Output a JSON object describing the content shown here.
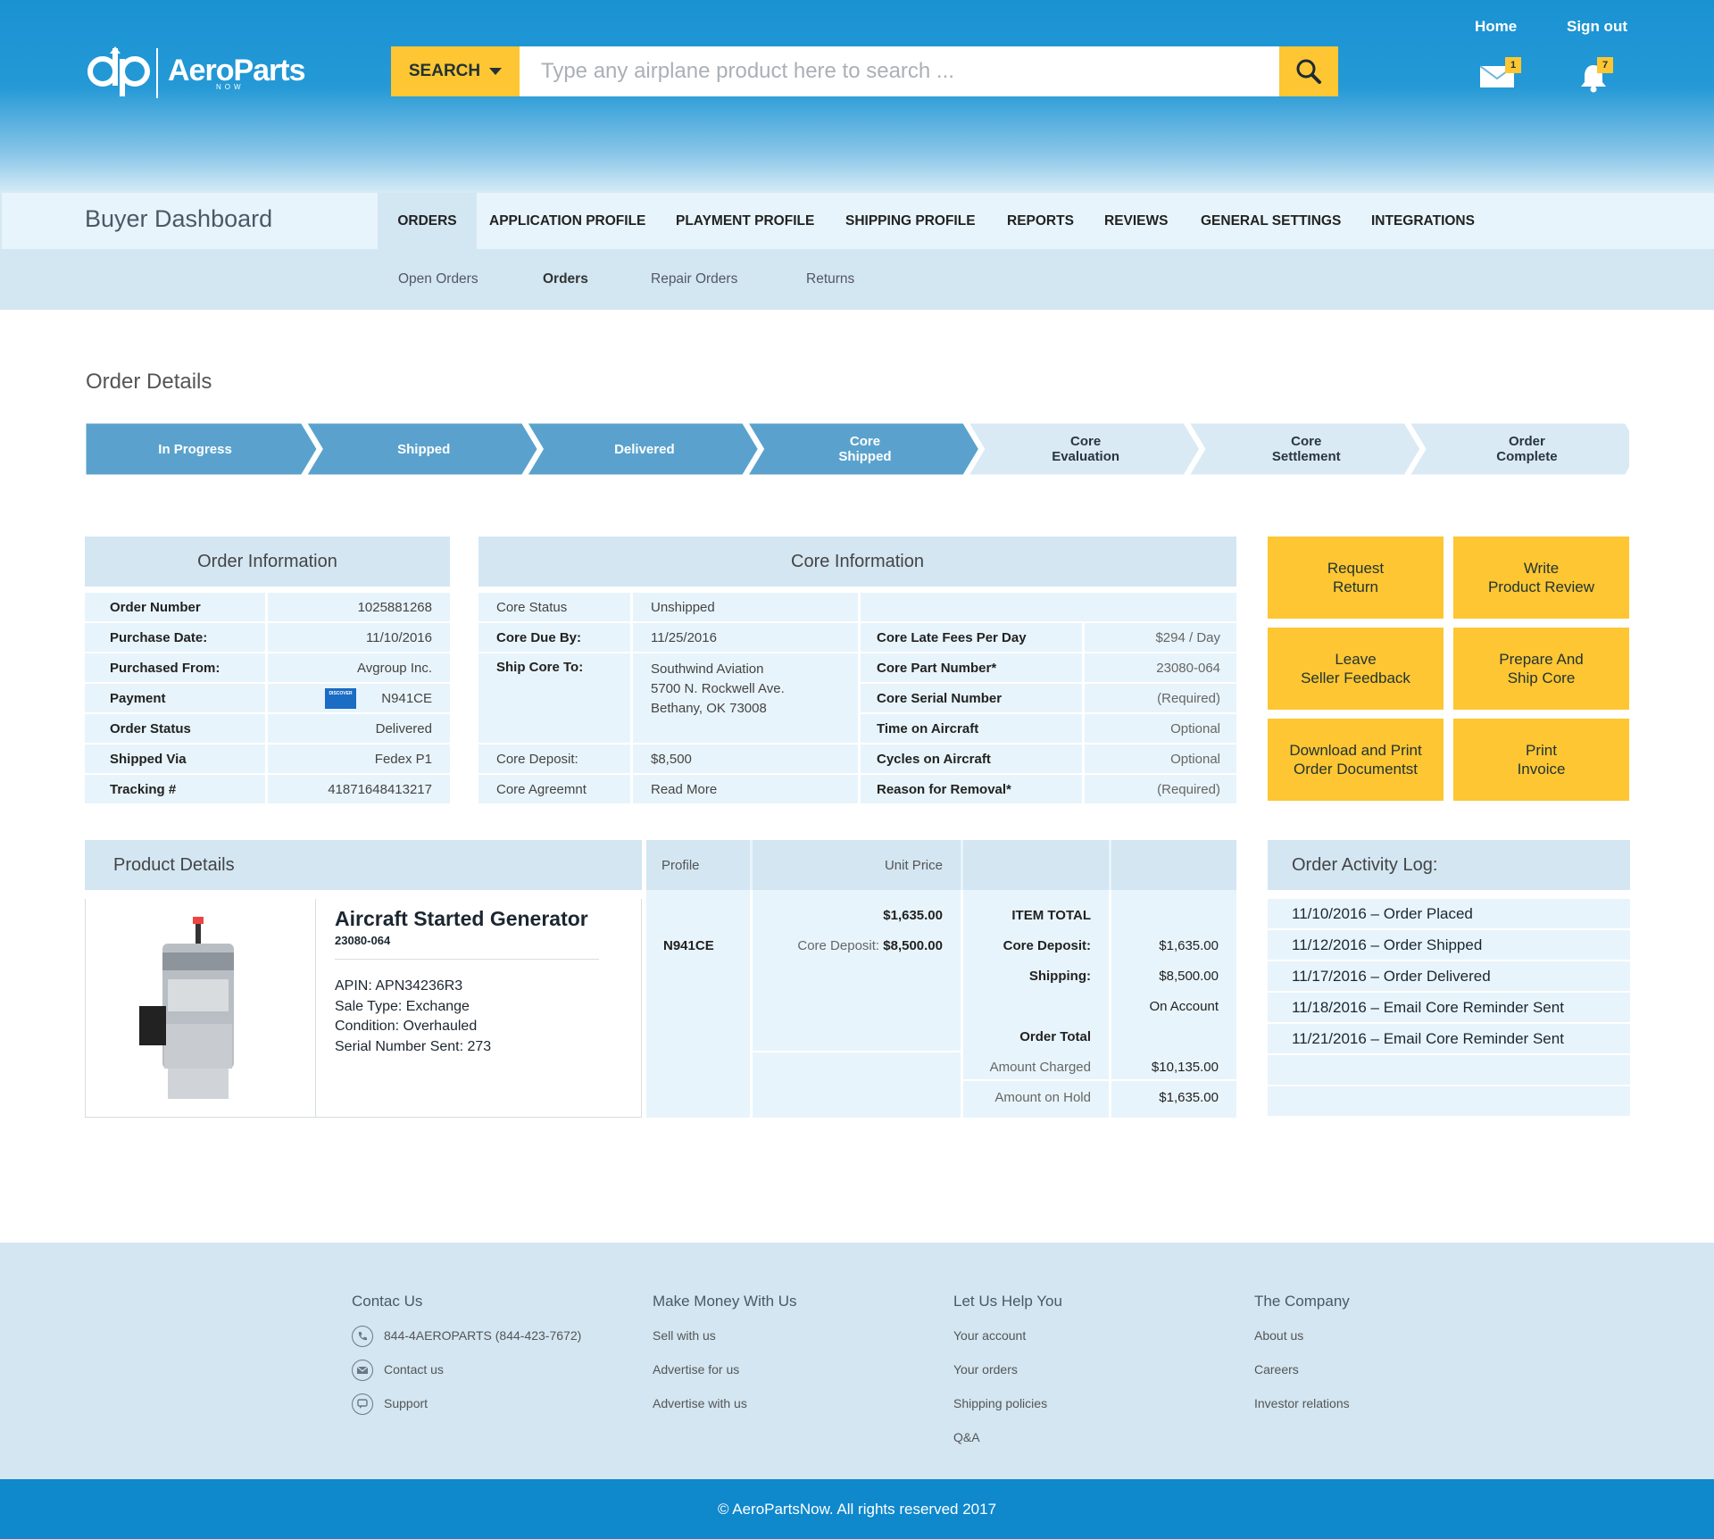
{
  "brand": {
    "name": "AeroParts",
    "tag": "NOW",
    "colors": {
      "primary": "#1a92d2",
      "accent": "#fdc632",
      "panel": "#d3e6f2"
    }
  },
  "search": {
    "dropdown_label": "SEARCH",
    "placeholder": "Type any airplane product here to search ..."
  },
  "top_links": {
    "home": "Home",
    "signout": "Sign out"
  },
  "badges": {
    "mail": "1",
    "notifications": "7"
  },
  "nav": {
    "title": "Buyer Dashboard",
    "tabs": [
      "ORDERS",
      "APPLICATION PROFILE",
      "PLAYMENT PROFILE",
      "SHIPPING PROFILE",
      "REPORTS",
      "REVIEWS",
      "GENERAL SETTINGS",
      "INTEGRATIONS"
    ],
    "active_tab": "ORDERS"
  },
  "subnav": {
    "tabs": [
      "Open Orders",
      "Orders",
      "Repair Orders",
      "Returns"
    ],
    "active_tab": "Orders"
  },
  "order_details_title": "Order Details",
  "steps": [
    {
      "line1": "In Progress",
      "line2": "",
      "done": true
    },
    {
      "line1": "Shipped",
      "line2": "",
      "done": true
    },
    {
      "line1": "Delivered",
      "line2": "",
      "done": true
    },
    {
      "line1": "Core",
      "line2": "Shipped",
      "done": true
    },
    {
      "line1": "Core",
      "line2": "Evaluation",
      "done": false
    },
    {
      "line1": "Core",
      "line2": "Settlement",
      "done": false
    },
    {
      "line1": "Order",
      "line2": "Complete",
      "done": false
    }
  ],
  "order_info": {
    "title": "Order Information",
    "rows": [
      {
        "label": "Order Number",
        "value": "1025881268"
      },
      {
        "label": "Purchase Date:",
        "value": "11/10/2016"
      },
      {
        "label": "Purchased From:",
        "value": "Avgroup Inc."
      },
      {
        "label": "Payment",
        "value": "N941CE"
      },
      {
        "label": "Order Status",
        "value": "Delivered"
      },
      {
        "label": "Shipped Via",
        "value": "Fedex P1"
      },
      {
        "label": "Tracking #",
        "value": "41871648413217"
      }
    ],
    "card_text": "DISCOVER"
  },
  "core_info": {
    "title": "Core Information",
    "left": [
      {
        "label": "Core Status",
        "value": "Unshipped",
        "bold": false
      },
      {
        "label": "Core Due By:",
        "value": "11/25/2016",
        "bold": true
      },
      {
        "label": "Ship Core To:",
        "value_lines": [
          "Southwind Aviation",
          "5700 N. Rockwell Ave.",
          "Bethany, OK 73008"
        ],
        "bold": true
      },
      {
        "label": "Core Deposit:",
        "value": "$8,500",
        "bold": false
      },
      {
        "label": "Core Agreemnt",
        "value": "Read More",
        "bold": false
      }
    ],
    "right": [
      {
        "label": "Core Late Fees Per Day",
        "value": "$294 / Day"
      },
      {
        "label": "Core Part Number*",
        "value": "23080-064"
      },
      {
        "label": "Core Serial Number",
        "value": "(Required)"
      },
      {
        "label": "Time on Aircraft",
        "value": "Optional"
      },
      {
        "label": "Cycles on Aircraft",
        "value": "Optional"
      },
      {
        "label": "Reason for Removal*",
        "value": "(Required)"
      }
    ]
  },
  "actions": [
    "Request\nReturn",
    "Write\nProduct Review",
    "Leave\nSeller Feedback",
    "Prepare And\nShip Core",
    "Download and Print\nOrder Documentst",
    "Print\nInvoice"
  ],
  "product": {
    "section_title": "Product Details",
    "name": "Aircraft Started Generator",
    "part": "23080-064",
    "apin": "APIN: APN34236R3",
    "sale_type": "Sale Type: Exchange",
    "condition": "Condition: Overhauled",
    "serial": "Serial Number Sent: 273"
  },
  "pricing": {
    "profile_header": "Profile",
    "unit_price_header": "Unit Price",
    "profile_value": "N941CE",
    "unit_price": "$1,635.00",
    "core_deposit_label": "Core Deposit:",
    "core_deposit_value": "$8,500.00",
    "summary": [
      {
        "label": "ITEM TOTAL",
        "value": ""
      },
      {
        "label": "Core Deposit:",
        "value": "$1,635.00"
      },
      {
        "label": "Shipping:",
        "value": "$8,500.00"
      },
      {
        "label": "",
        "value": "On Account"
      },
      {
        "label": "Order Total",
        "value": ""
      }
    ],
    "amount_charged_label": "Amount Charged",
    "amount_charged": "$10,135.00",
    "amount_hold_label": "Amount on Hold",
    "amount_hold": "$1,635.00"
  },
  "activity": {
    "title": "Order Activity Log:",
    "items": [
      "11/10/2016 – Order Placed",
      "11/12/2016 – Order Shipped",
      "11/17/2016 – Order Delivered",
      "11/18/2016 – Email Core Reminder Sent",
      "11/21/2016 – Email Core Reminder Sent"
    ]
  },
  "footer": {
    "columns": [
      {
        "title": "Contac Us",
        "links": [
          "844-4AEROPARTS (844-423-7672)",
          "Contact us",
          "Support"
        ],
        "icons": [
          "phone-icon",
          "mail-icon",
          "chat-icon"
        ]
      },
      {
        "title": "Make Money With Us",
        "links": [
          "Sell with us",
          "Advertise for us",
          "Advertise with us"
        ]
      },
      {
        "title": "Let Us Help You",
        "links": [
          "Your account",
          "Your orders",
          "Shipping policies",
          "Q&A"
        ]
      },
      {
        "title": "The Company",
        "links": [
          "About us",
          "Careers",
          "Investor relations"
        ]
      }
    ],
    "copyright": "© AeroPartsNow. All rights reserved 2017"
  }
}
